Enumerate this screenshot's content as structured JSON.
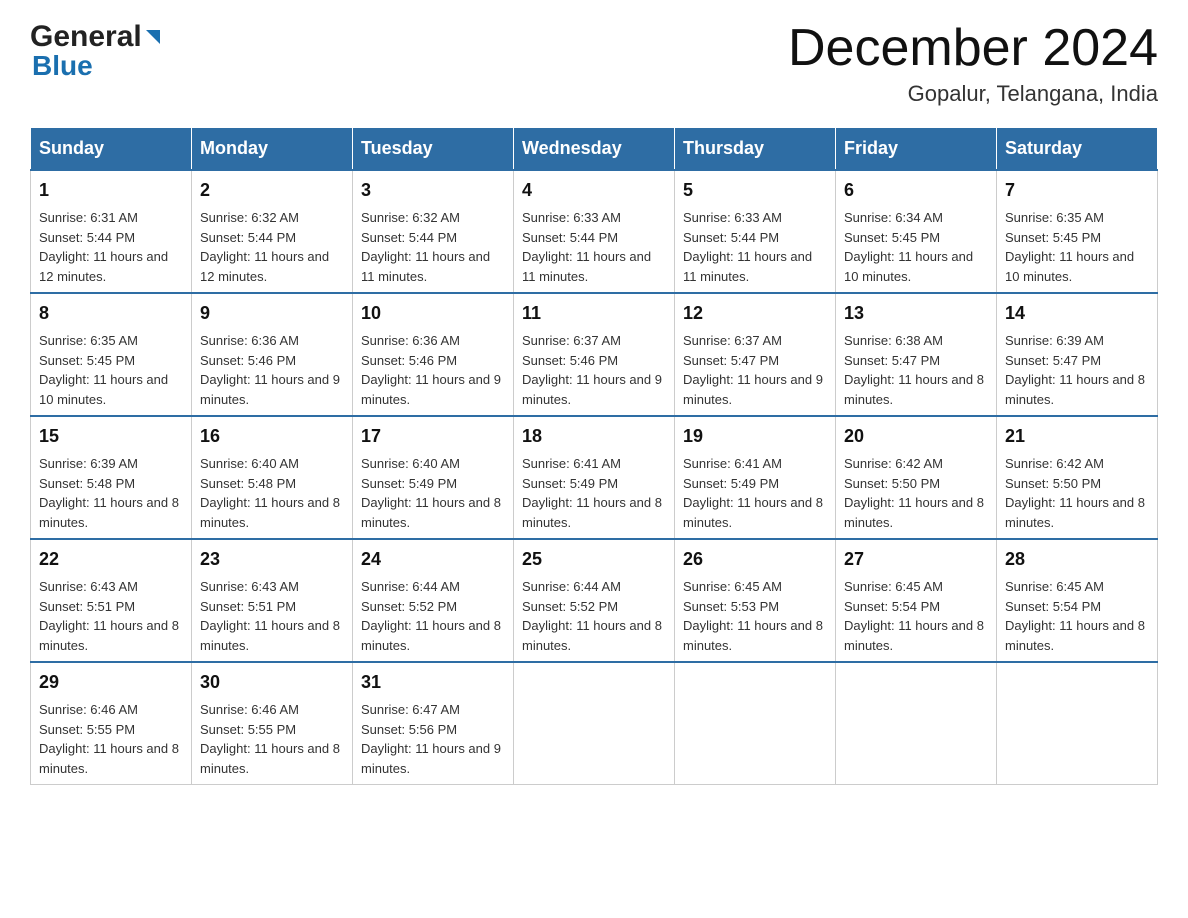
{
  "logo": {
    "general": "General",
    "blue": "Blue"
  },
  "title": "December 2024",
  "subtitle": "Gopalur, Telangana, India",
  "weekdays": [
    "Sunday",
    "Monday",
    "Tuesday",
    "Wednesday",
    "Thursday",
    "Friday",
    "Saturday"
  ],
  "weeks": [
    [
      {
        "day": "1",
        "sunrise": "6:31 AM",
        "sunset": "5:44 PM",
        "daylight": "11 hours and 12 minutes."
      },
      {
        "day": "2",
        "sunrise": "6:32 AM",
        "sunset": "5:44 PM",
        "daylight": "11 hours and 12 minutes."
      },
      {
        "day": "3",
        "sunrise": "6:32 AM",
        "sunset": "5:44 PM",
        "daylight": "11 hours and 11 minutes."
      },
      {
        "day": "4",
        "sunrise": "6:33 AM",
        "sunset": "5:44 PM",
        "daylight": "11 hours and 11 minutes."
      },
      {
        "day": "5",
        "sunrise": "6:33 AM",
        "sunset": "5:44 PM",
        "daylight": "11 hours and 11 minutes."
      },
      {
        "day": "6",
        "sunrise": "6:34 AM",
        "sunset": "5:45 PM",
        "daylight": "11 hours and 10 minutes."
      },
      {
        "day": "7",
        "sunrise": "6:35 AM",
        "sunset": "5:45 PM",
        "daylight": "11 hours and 10 minutes."
      }
    ],
    [
      {
        "day": "8",
        "sunrise": "6:35 AM",
        "sunset": "5:45 PM",
        "daylight": "11 hours and 10 minutes."
      },
      {
        "day": "9",
        "sunrise": "6:36 AM",
        "sunset": "5:46 PM",
        "daylight": "11 hours and 9 minutes."
      },
      {
        "day": "10",
        "sunrise": "6:36 AM",
        "sunset": "5:46 PM",
        "daylight": "11 hours and 9 minutes."
      },
      {
        "day": "11",
        "sunrise": "6:37 AM",
        "sunset": "5:46 PM",
        "daylight": "11 hours and 9 minutes."
      },
      {
        "day": "12",
        "sunrise": "6:37 AM",
        "sunset": "5:47 PM",
        "daylight": "11 hours and 9 minutes."
      },
      {
        "day": "13",
        "sunrise": "6:38 AM",
        "sunset": "5:47 PM",
        "daylight": "11 hours and 8 minutes."
      },
      {
        "day": "14",
        "sunrise": "6:39 AM",
        "sunset": "5:47 PM",
        "daylight": "11 hours and 8 minutes."
      }
    ],
    [
      {
        "day": "15",
        "sunrise": "6:39 AM",
        "sunset": "5:48 PM",
        "daylight": "11 hours and 8 minutes."
      },
      {
        "day": "16",
        "sunrise": "6:40 AM",
        "sunset": "5:48 PM",
        "daylight": "11 hours and 8 minutes."
      },
      {
        "day": "17",
        "sunrise": "6:40 AM",
        "sunset": "5:49 PM",
        "daylight": "11 hours and 8 minutes."
      },
      {
        "day": "18",
        "sunrise": "6:41 AM",
        "sunset": "5:49 PM",
        "daylight": "11 hours and 8 minutes."
      },
      {
        "day": "19",
        "sunrise": "6:41 AM",
        "sunset": "5:49 PM",
        "daylight": "11 hours and 8 minutes."
      },
      {
        "day": "20",
        "sunrise": "6:42 AM",
        "sunset": "5:50 PM",
        "daylight": "11 hours and 8 minutes."
      },
      {
        "day": "21",
        "sunrise": "6:42 AM",
        "sunset": "5:50 PM",
        "daylight": "11 hours and 8 minutes."
      }
    ],
    [
      {
        "day": "22",
        "sunrise": "6:43 AM",
        "sunset": "5:51 PM",
        "daylight": "11 hours and 8 minutes."
      },
      {
        "day": "23",
        "sunrise": "6:43 AM",
        "sunset": "5:51 PM",
        "daylight": "11 hours and 8 minutes."
      },
      {
        "day": "24",
        "sunrise": "6:44 AM",
        "sunset": "5:52 PM",
        "daylight": "11 hours and 8 minutes."
      },
      {
        "day": "25",
        "sunrise": "6:44 AM",
        "sunset": "5:52 PM",
        "daylight": "11 hours and 8 minutes."
      },
      {
        "day": "26",
        "sunrise": "6:45 AM",
        "sunset": "5:53 PM",
        "daylight": "11 hours and 8 minutes."
      },
      {
        "day": "27",
        "sunrise": "6:45 AM",
        "sunset": "5:54 PM",
        "daylight": "11 hours and 8 minutes."
      },
      {
        "day": "28",
        "sunrise": "6:45 AM",
        "sunset": "5:54 PM",
        "daylight": "11 hours and 8 minutes."
      }
    ],
    [
      {
        "day": "29",
        "sunrise": "6:46 AM",
        "sunset": "5:55 PM",
        "daylight": "11 hours and 8 minutes."
      },
      {
        "day": "30",
        "sunrise": "6:46 AM",
        "sunset": "5:55 PM",
        "daylight": "11 hours and 8 minutes."
      },
      {
        "day": "31",
        "sunrise": "6:47 AM",
        "sunset": "5:56 PM",
        "daylight": "11 hours and 9 minutes."
      },
      null,
      null,
      null,
      null
    ]
  ]
}
